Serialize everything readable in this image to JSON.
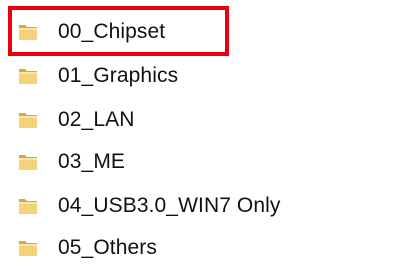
{
  "folders": [
    {
      "label": "00_Chipset",
      "icon": "folder-icon"
    },
    {
      "label": "01_Graphics",
      "icon": "folder-icon"
    },
    {
      "label": "02_LAN",
      "icon": "folder-icon"
    },
    {
      "label": "03_ME",
      "icon": "folder-icon"
    },
    {
      "label": "04_USB3.0_WIN7 Only",
      "icon": "folder-icon"
    },
    {
      "label": "05_Others",
      "icon": "folder-icon"
    }
  ],
  "highlight": {
    "target": "00_Chipset",
    "color": "#e8000d"
  },
  "colors": {
    "folder_light": "#f3d27a",
    "folder_dark": "#d8a73c",
    "text": "#111111"
  }
}
